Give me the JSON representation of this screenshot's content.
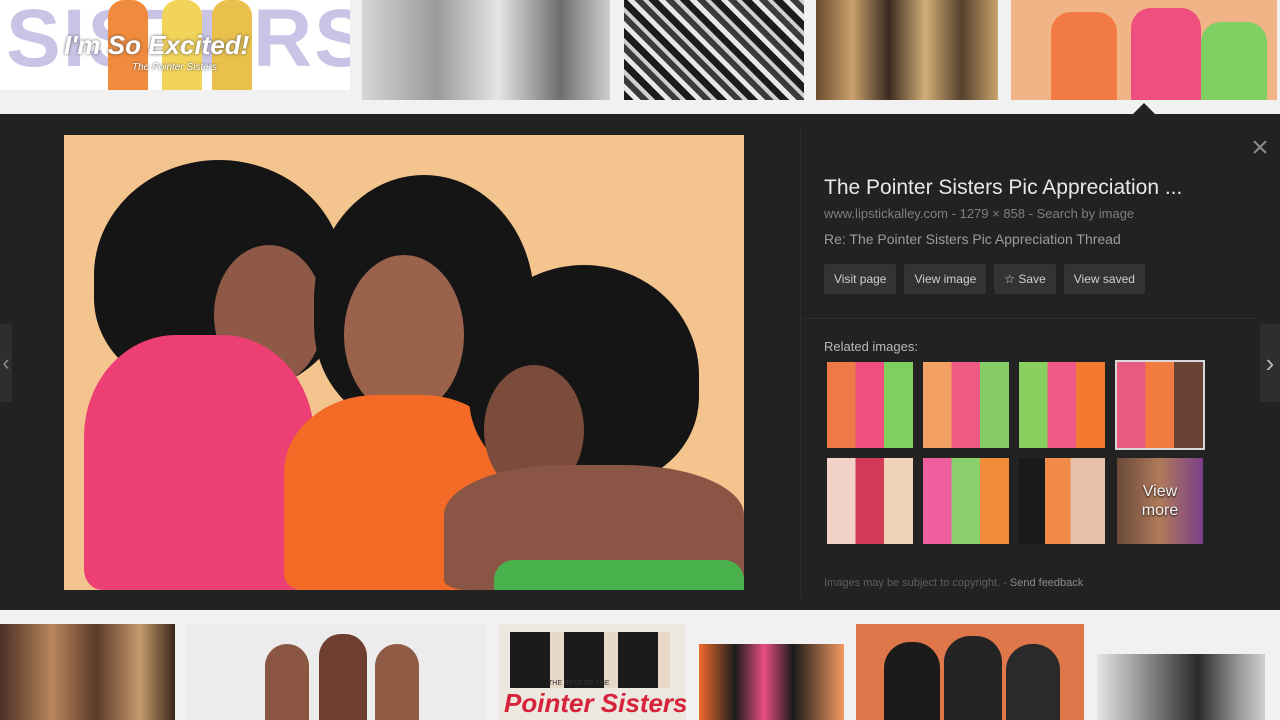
{
  "top_strip": {
    "first_thumb_title": "I'm So Excited!",
    "first_thumb_subtitle": "The Pointer Sisters",
    "first_thumb_bg_text": "SISTERS"
  },
  "preview": {
    "title": "The Pointer Sisters Pic Appreciation ...",
    "source": "www.lipstickalley.com",
    "dimensions": "1279 × 858",
    "search_by_image": "Search by image",
    "description": "Re: The Pointer Sisters Pic Appreciation Thread",
    "buttons": {
      "visit_page": "Visit page",
      "view_image": "View image",
      "save": "Save",
      "view_saved": "View saved"
    },
    "related_label": "Related images:",
    "view_more": "View\nmore",
    "copyright": "Images may be subject to copyright.",
    "send_feedback": "Send feedback",
    "close_glyph": "×",
    "nav_prev_glyph": "‹",
    "nav_next_glyph": "›",
    "star_glyph": "☆"
  },
  "bottom_strip": {
    "album_text": "Pointer Sisters",
    "album_sub": "THE BEST OF THE"
  },
  "colors": {
    "panel_bg": "#222222",
    "button_bg": "#333333",
    "page_bg": "#f1f1f1",
    "photo_bg": "#f4c48f"
  }
}
